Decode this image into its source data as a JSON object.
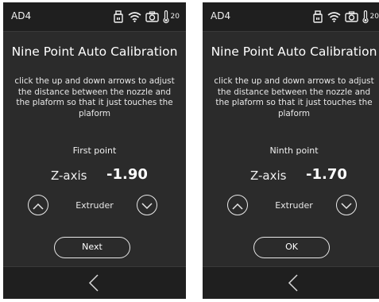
{
  "screens": [
    {
      "device_name": "AD4",
      "temperature": "20",
      "title": "Nine Point Auto Calibration",
      "instructions": "click the up and down arrows to adjust the distance between the nozzle and the plaform so that it just touches the plaform",
      "point_label": "First point",
      "axis_label": "Z-axis",
      "axis_value": "-1.90",
      "mode_label": "Extruder",
      "action_label": "Next",
      "icons": [
        "usb-icon",
        "wifi-icon",
        "camera-icon",
        "thermometer-icon",
        "arrow-up-icon",
        "arrow-down-icon",
        "back-arrow-icon"
      ]
    },
    {
      "device_name": "AD4",
      "temperature": "20",
      "title": "Nine Point Auto Calibration",
      "instructions": "click the up and down arrows to adjust the distance between the nozzle and the plaform so that it just touches the plaform",
      "point_label": "Ninth point",
      "axis_label": "Z-axis",
      "axis_value": "-1.70",
      "mode_label": "Extruder",
      "action_label": "OK",
      "icons": [
        "usb-icon",
        "wifi-icon",
        "camera-icon",
        "thermometer-icon",
        "arrow-up-icon",
        "arrow-down-icon",
        "back-arrow-icon"
      ]
    }
  ],
  "colors": {
    "screen_background": "#2b2b2b",
    "bar_background": "#1f1f1f",
    "text": "#ffffff"
  }
}
